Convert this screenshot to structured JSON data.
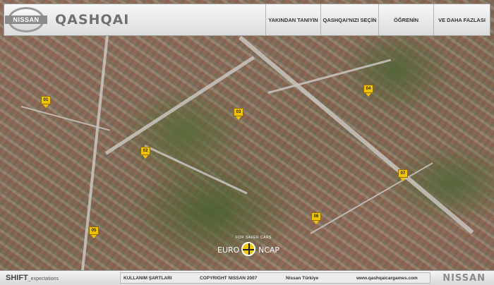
{
  "header": {
    "brand": "NISSAN",
    "model": "QASHQAI",
    "nav": [
      {
        "label": "YAKINDAN TANIYIN"
      },
      {
        "label": "QASHQAI'NIZI SEÇİN"
      },
      {
        "label": "ÖĞRENİN"
      },
      {
        "label": "VE DAHA FAZLASI"
      }
    ]
  },
  "map": {
    "markers": [
      {
        "label": "01"
      },
      {
        "label": "02"
      },
      {
        "label": "03"
      },
      {
        "label": "04"
      },
      {
        "label": "05"
      },
      {
        "label": "06"
      },
      {
        "label": "07"
      }
    ],
    "marker_color": "#f0c200",
    "euroncap": {
      "left": "EURO",
      "right": "NCAP",
      "arc": "FOR SAFER CARS"
    }
  },
  "footer": {
    "shift": "SHIFT",
    "shift_suffix": "_expectations",
    "links": [
      {
        "label": "KULLANIM ŞARTLARI"
      },
      {
        "label": "COPYRIGHT NISSAN 2007"
      },
      {
        "label": "Nissan Türkiye"
      },
      {
        "label": "www.qashqaicargames.com"
      }
    ],
    "logo": "NISSAN"
  }
}
